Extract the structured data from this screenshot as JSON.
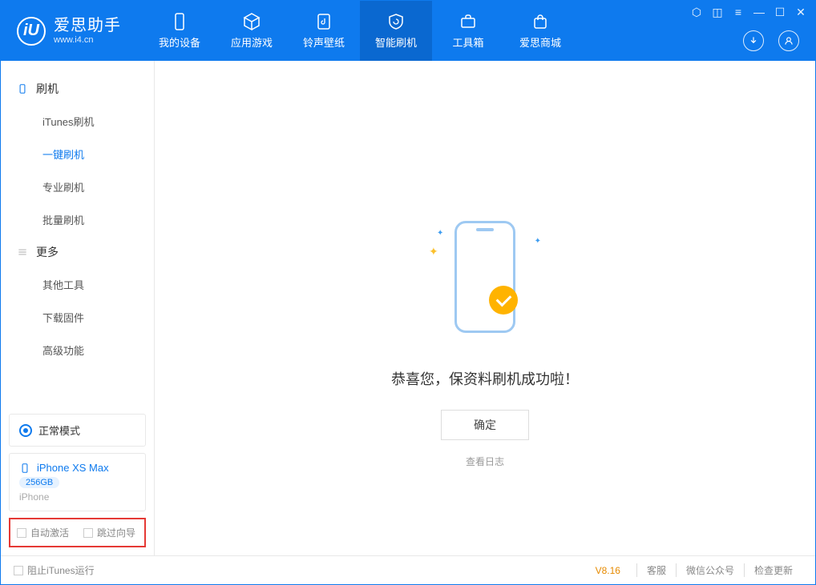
{
  "logo": {
    "title": "爱思助手",
    "subtitle": "www.i4.cn",
    "mark": "iU"
  },
  "nav": {
    "device": "我的设备",
    "apps": "应用游戏",
    "ringtones": "铃声壁纸",
    "flash": "智能刷机",
    "tools": "工具箱",
    "store": "爱思商城"
  },
  "sidebar": {
    "group_flash": "刷机",
    "items_flash": {
      "itunes": "iTunes刷机",
      "onekey": "一键刷机",
      "pro": "专业刷机",
      "batch": "批量刷机"
    },
    "group_more": "更多",
    "items_more": {
      "other": "其他工具",
      "firmware": "下载固件",
      "advanced": "高级功能"
    }
  },
  "mode_panel": {
    "label": "正常模式"
  },
  "device_panel": {
    "name": "iPhone XS Max",
    "capacity": "256GB",
    "type": "iPhone"
  },
  "options": {
    "auto_activate": "自动激活",
    "skip_guide": "跳过向导"
  },
  "main": {
    "success_text": "恭喜您，保资料刷机成功啦！",
    "ok_button": "确定",
    "view_log": "查看日志"
  },
  "footer": {
    "block_itunes": "阻止iTunes运行",
    "version": "V8.16",
    "support": "客服",
    "wechat": "微信公众号",
    "update": "检查更新"
  }
}
